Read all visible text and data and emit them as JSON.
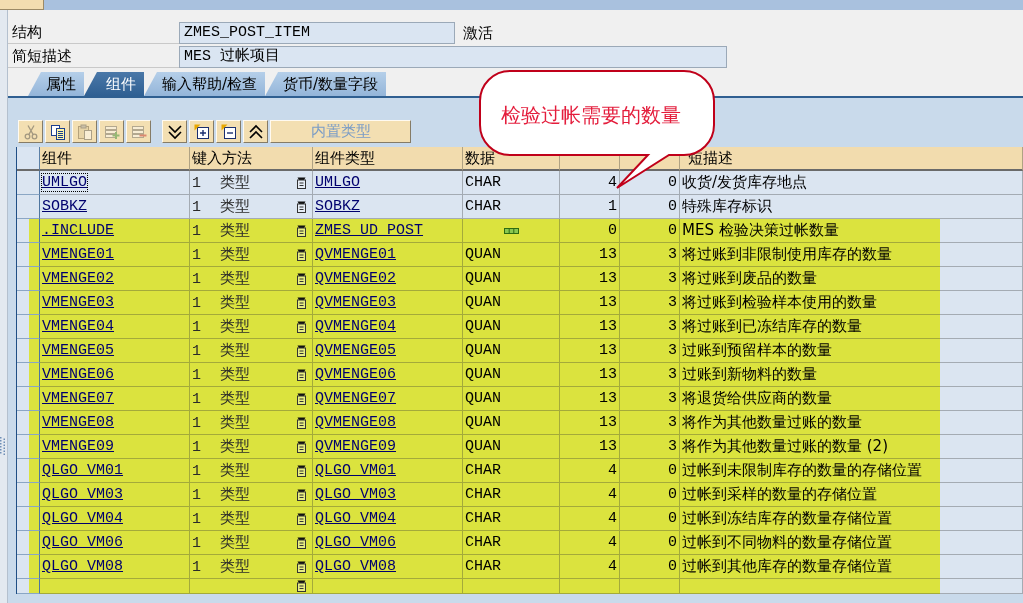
{
  "form": {
    "rows": [
      {
        "label": "结构",
        "value": "ZMES_POST_ITEM",
        "status": "激活"
      },
      {
        "label": "简短描述",
        "value": "MES 过帐项目"
      }
    ]
  },
  "tabs": [
    {
      "label": "属性",
      "selected": false
    },
    {
      "label": "组件",
      "selected": true
    },
    {
      "label": "输入帮助/检查",
      "selected": false
    },
    {
      "label": "货币/数量字段",
      "selected": false
    }
  ],
  "toolbar": {
    "groups": [
      {
        "buttons": [
          {
            "kind": "cut",
            "disabled": true
          },
          {
            "kind": "copy",
            "disabled": false
          },
          {
            "kind": "paste",
            "disabled": true
          },
          {
            "kind": "insert_row",
            "disabled": true
          },
          {
            "kind": "delete_row",
            "disabled": true
          }
        ]
      },
      {
        "buttons": [
          {
            "kind": "chevron_down",
            "disabled": false
          },
          {
            "kind": "plus_box",
            "disabled": false
          },
          {
            "kind": "minus_box",
            "disabled": false
          },
          {
            "kind": "chevron_up",
            "disabled": false
          },
          {
            "kind": "text",
            "label": "内置类型",
            "disabled": true
          }
        ]
      }
    ]
  },
  "table": {
    "columns": [
      {
        "label": "组件"
      },
      {
        "label": "键入方法"
      },
      {
        "label": "组件类型"
      },
      {
        "label": "数据"
      },
      {},
      {},
      {
        "label": "短描述"
      }
    ],
    "rows": [
      {
        "kind": "field",
        "highlighted": false,
        "focused": true,
        "cells": [
          "UMLGO",
          "1 类型",
          "UMLGO",
          "CHAR",
          "4",
          "0",
          "收货/发货库存地点"
        ]
      },
      {
        "kind": "field",
        "highlighted": false,
        "focused": false,
        "cells": [
          "SOBKZ",
          "1 类型",
          "SOBKZ",
          "CHAR",
          "1",
          "0",
          "特殊库存标识"
        ]
      },
      {
        "kind": "include",
        "highlighted": true,
        "focused": false,
        "cells": [
          ".INCLUDE",
          "1 类型",
          "ZMES_UD_POST",
          null,
          "0",
          "0",
          "MES 检验决策过帐数量"
        ]
      },
      {
        "kind": "field",
        "highlighted": true,
        "focused": false,
        "cells": [
          "VMENGE01",
          "1 类型",
          "QVMENGE01",
          "QUAN",
          "13",
          "3",
          "将过账到非限制使用库存的数量"
        ]
      },
      {
        "kind": "field",
        "highlighted": true,
        "focused": false,
        "cells": [
          "VMENGE02",
          "1 类型",
          "QVMENGE02",
          "QUAN",
          "13",
          "3",
          "将过账到废品的数量"
        ]
      },
      {
        "kind": "field",
        "highlighted": true,
        "focused": false,
        "cells": [
          "VMENGE03",
          "1 类型",
          "QVMENGE03",
          "QUAN",
          "13",
          "3",
          "将过账到检验样本使用的数量"
        ]
      },
      {
        "kind": "field",
        "highlighted": true,
        "focused": false,
        "cells": [
          "VMENGE04",
          "1 类型",
          "QVMENGE04",
          "QUAN",
          "13",
          "3",
          "将过账到已冻结库存的数量"
        ]
      },
      {
        "kind": "field",
        "highlighted": true,
        "focused": false,
        "cells": [
          "VMENGE05",
          "1 类型",
          "QVMENGE05",
          "QUAN",
          "13",
          "3",
          "过账到预留样本的数量"
        ]
      },
      {
        "kind": "field",
        "highlighted": true,
        "focused": false,
        "cells": [
          "VMENGE06",
          "1 类型",
          "QVMENGE06",
          "QUAN",
          "13",
          "3",
          "过账到新物料的数量"
        ]
      },
      {
        "kind": "field",
        "highlighted": true,
        "focused": false,
        "cells": [
          "VMENGE07",
          "1 类型",
          "QVMENGE07",
          "QUAN",
          "13",
          "3",
          "将退货给供应商的数量"
        ]
      },
      {
        "kind": "field",
        "highlighted": true,
        "focused": false,
        "cells": [
          "VMENGE08",
          "1 类型",
          "QVMENGE08",
          "QUAN",
          "13",
          "3",
          "将作为其他数量过账的数量"
        ]
      },
      {
        "kind": "field",
        "highlighted": true,
        "focused": false,
        "cells": [
          "VMENGE09",
          "1 类型",
          "QVMENGE09",
          "QUAN",
          "13",
          "3",
          "将作为其他数量过账的数量 (2)"
        ]
      },
      {
        "kind": "field",
        "highlighted": true,
        "focused": false,
        "cells": [
          "QLGO_VM01",
          "1 类型",
          "QLGO_VM01",
          "CHAR",
          "4",
          "0",
          "过帐到未限制库存的数量的存储位置"
        ]
      },
      {
        "kind": "field",
        "highlighted": true,
        "focused": false,
        "cells": [
          "QLGO_VM03",
          "1 类型",
          "QLGO_VM03",
          "CHAR",
          "4",
          "0",
          "过帐到采样的数量的存储位置"
        ]
      },
      {
        "kind": "field",
        "highlighted": true,
        "focused": false,
        "cells": [
          "QLGO_VM04",
          "1 类型",
          "QLGO_VM04",
          "CHAR",
          "4",
          "0",
          "过帐到冻结库存的数量存储位置"
        ]
      },
      {
        "kind": "field",
        "highlighted": true,
        "focused": false,
        "cells": [
          "QLGO_VM06",
          "1 类型",
          "QLGO_VM06",
          "CHAR",
          "4",
          "0",
          "过帐到不同物料的数量存储位置"
        ]
      },
      {
        "kind": "field",
        "highlighted": true,
        "focused": false,
        "cells": [
          "QLGO_VM08",
          "1 类型",
          "QLGO_VM08",
          "CHAR",
          "4",
          "0",
          "过帐到其他库存的数量存储位置"
        ]
      },
      {
        "kind": "empty",
        "highlighted": true
      }
    ]
  },
  "callout": {
    "text": "检验过帐需要的数量"
  }
}
